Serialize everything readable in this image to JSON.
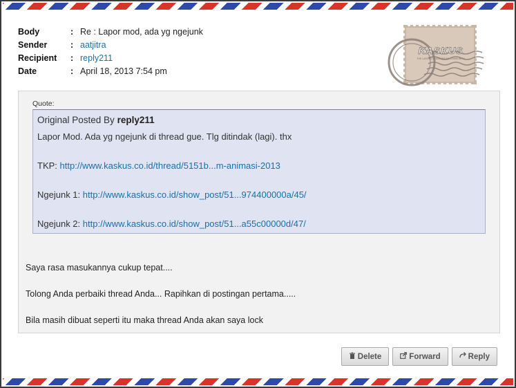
{
  "meta": {
    "body_label": "Body",
    "body_value": "Re : Lapor mod, ada yg ngejunk",
    "sender_label": "Sender",
    "sender_value": "aatjitra",
    "recipient_label": "Recipient",
    "recipient_value": "reply211",
    "date_label": "Date",
    "date_value": "April 18, 2013 7:54 pm",
    "colon": ":"
  },
  "stamp": {
    "brand": "KASKUS",
    "tagline": "THE LARGEST INDONESIAN COMMUNITY"
  },
  "quote": {
    "label": "Quote:",
    "original_prefix": "Original Posted By",
    "author": "reply211",
    "line1": "Lapor Mod. Ada yg ngejunk di thread gue. Tlg ditindak (lagi). thx",
    "tkp_prefix": "TKP:",
    "tkp_link": "http://www.kaskus.co.id/thread/5151b...m-animasi-2013",
    "junk1_prefix": "Ngejunk 1:",
    "junk1_link": "http://www.kaskus.co.id/show_post/51...974400000a/45/",
    "junk2_prefix": "Ngejunk 2:",
    "junk2_link": "http://www.kaskus.co.id/show_post/51...a55c00000d/47/"
  },
  "reply": {
    "line1": "Saya rasa masukannya cukup tepat....",
    "line2": "Tolong Anda perbaiki thread Anda... Rapihkan di postingan pertama.....",
    "line3": "Bila masih dibuat seperti itu maka thread Anda akan saya lock"
  },
  "actions": {
    "delete_label": "Delete",
    "forward_label": "Forward",
    "reply_label": "Reply"
  },
  "colors": {
    "airmail_red": "#d9342b",
    "airmail_blue": "#2f49a8",
    "link": "#1a6fa8",
    "quote_bg": "#dfe3f2"
  }
}
